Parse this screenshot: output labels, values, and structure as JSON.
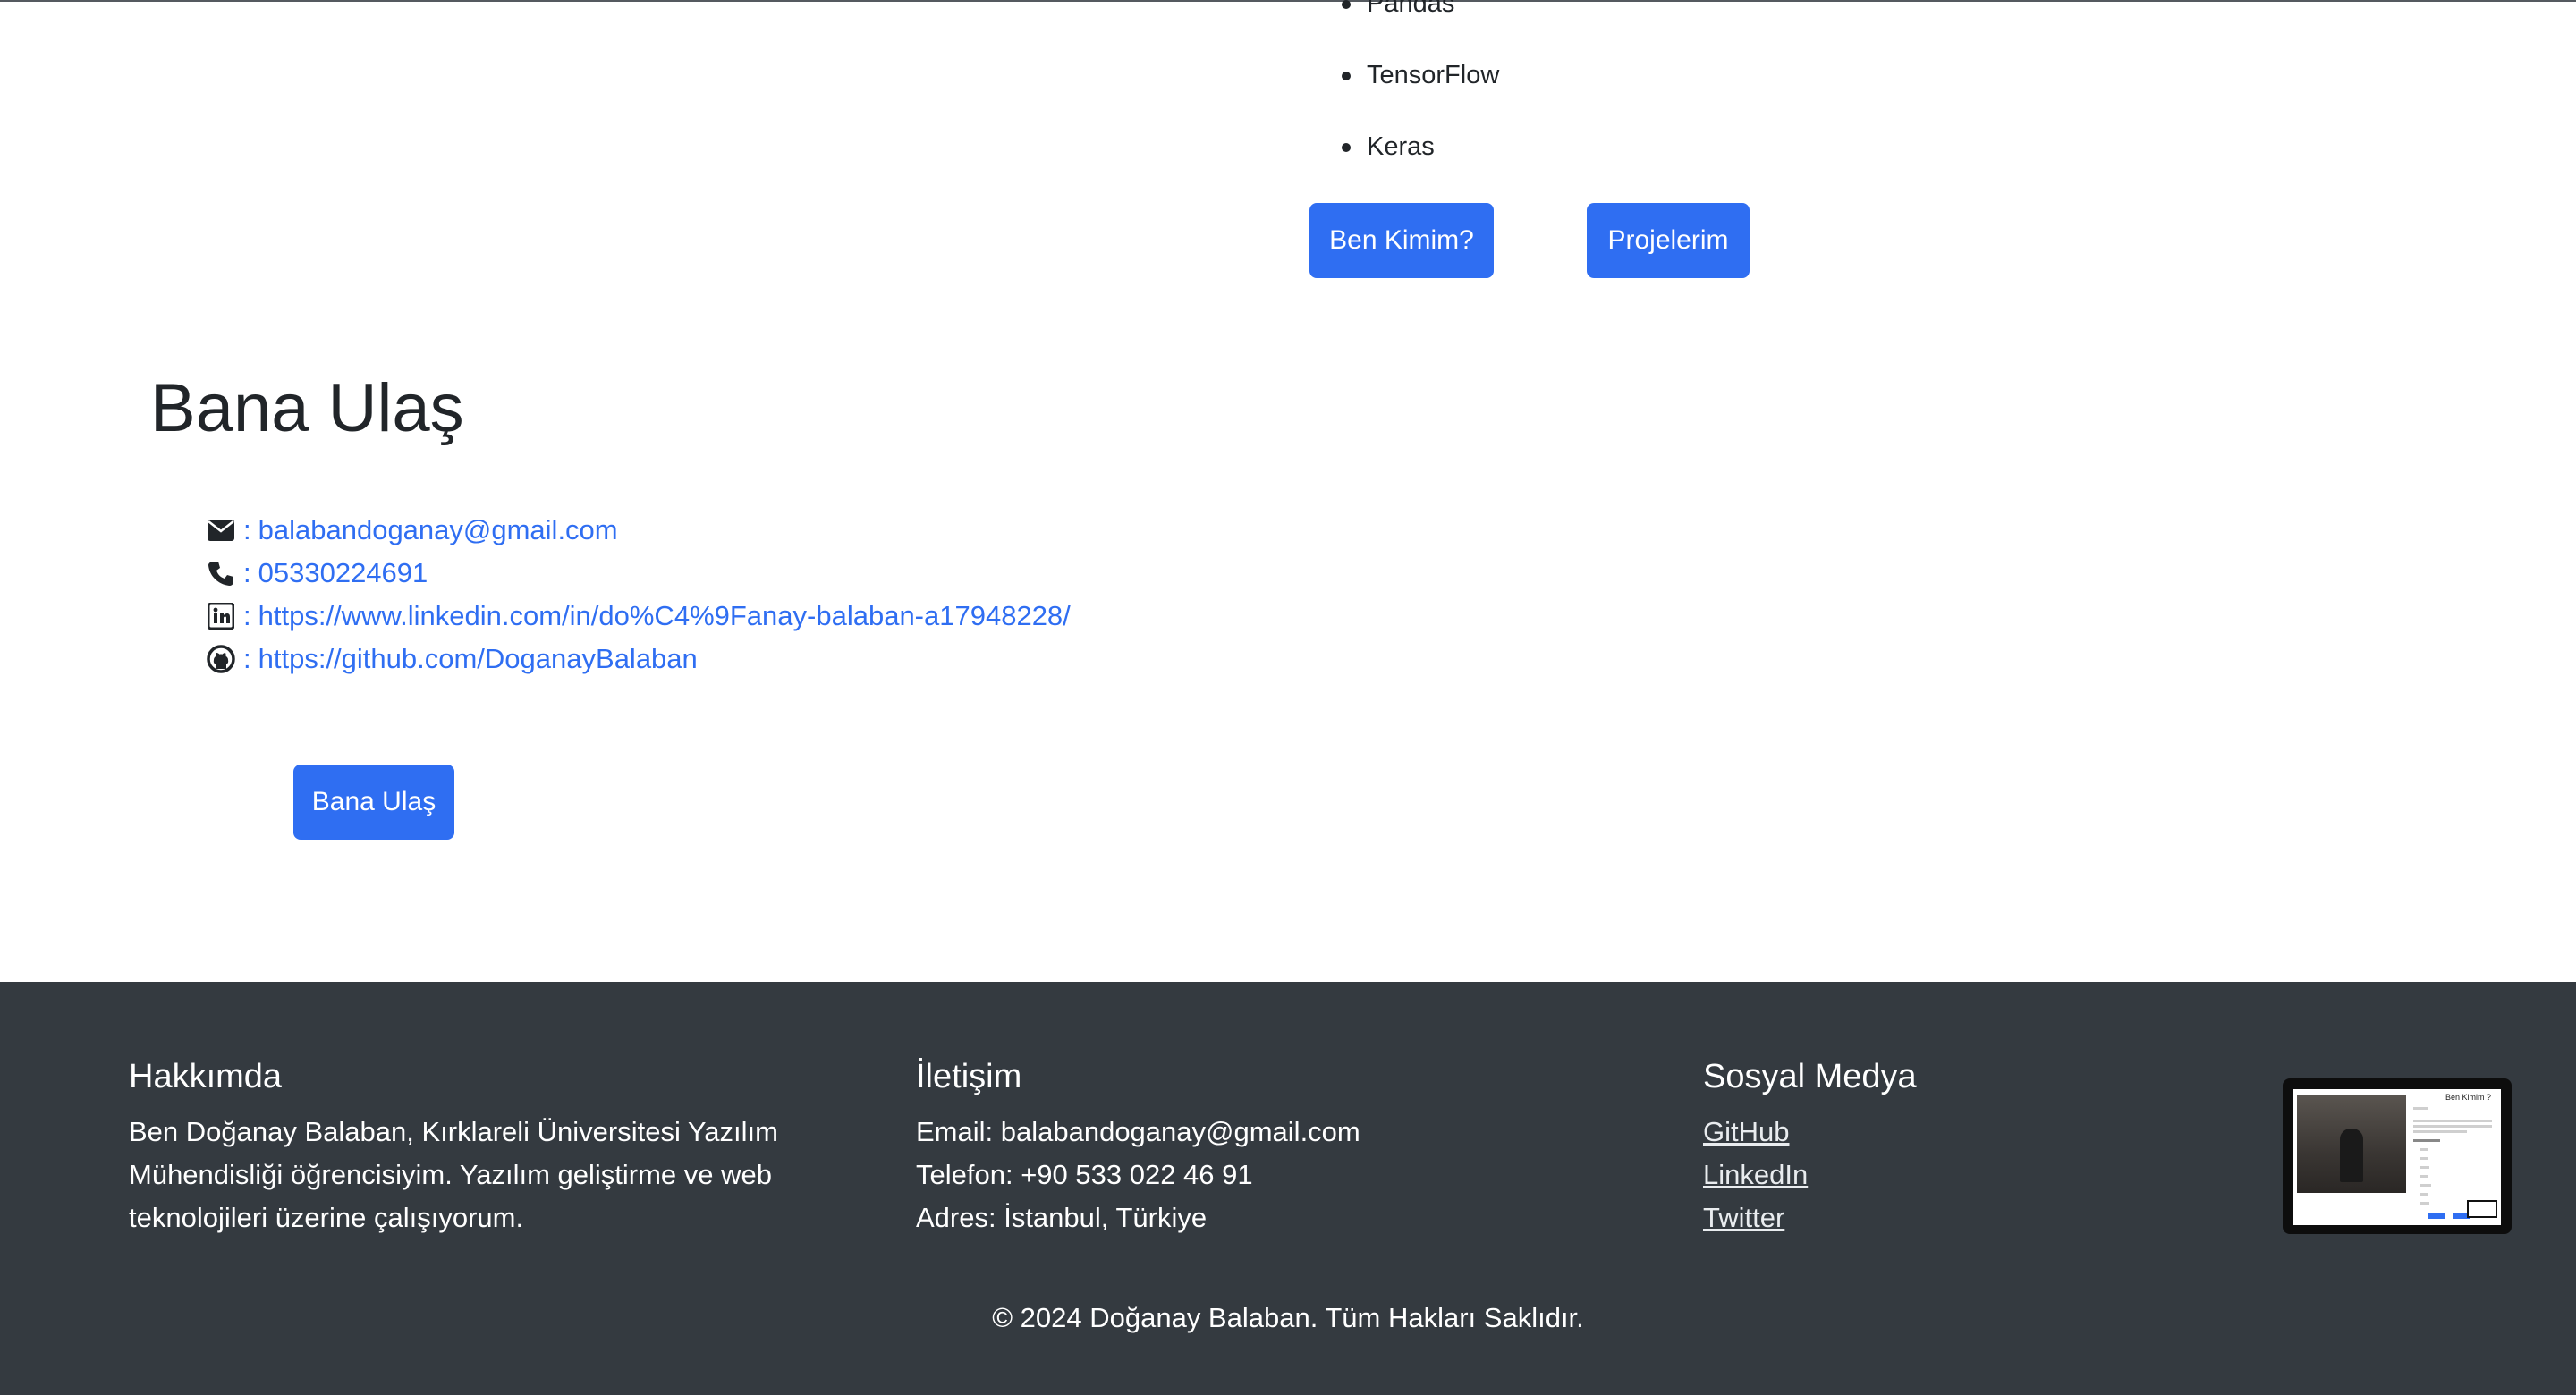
{
  "skills": {
    "items": [
      "Pandas",
      "TensorFlow",
      "Keras"
    ]
  },
  "nav_buttons": {
    "about": "Ben Kimim?",
    "projects": "Projelerim"
  },
  "contact": {
    "title": "Bana Ulaş",
    "separator": ":",
    "email": "balabandoganay@gmail.com",
    "phone": "05330224691",
    "linkedin": "https://www.linkedin.com/in/do%C4%9Fanay-balaban-a17948228/",
    "github": "https://github.com/DoganayBalaban",
    "button": "Bana Ulaş",
    "icons": [
      "envelope-icon",
      "phone-icon",
      "linkedin-icon",
      "github-icon"
    ]
  },
  "footer": {
    "about": {
      "title": "Hakkımda",
      "text": "Ben Doğanay Balaban, Kırklareli Üniversitesi Yazılım Mühendisliği öğrencisiyim. Yazılım geliştirme ve web teknolojileri üzerine çalışıyorum."
    },
    "contact": {
      "title": "İletişim",
      "email": "Email: balabandoganay@gmail.com",
      "phone": "Telefon: +90 533 022 46 91",
      "address": "Adres: İstanbul, Türkiye"
    },
    "social": {
      "title": "Sosyal Medya",
      "links": [
        "GitHub",
        "LinkedIn",
        "Twitter"
      ]
    },
    "copyright": "© 2024 Doğanay Balaban. Tüm Hakları Saklıdır."
  },
  "thumbnail": {
    "title": "Ben Kimim ?"
  },
  "colors": {
    "accent": "#2f6ef2",
    "footer_bg": "#343a40",
    "text": "#212529"
  }
}
